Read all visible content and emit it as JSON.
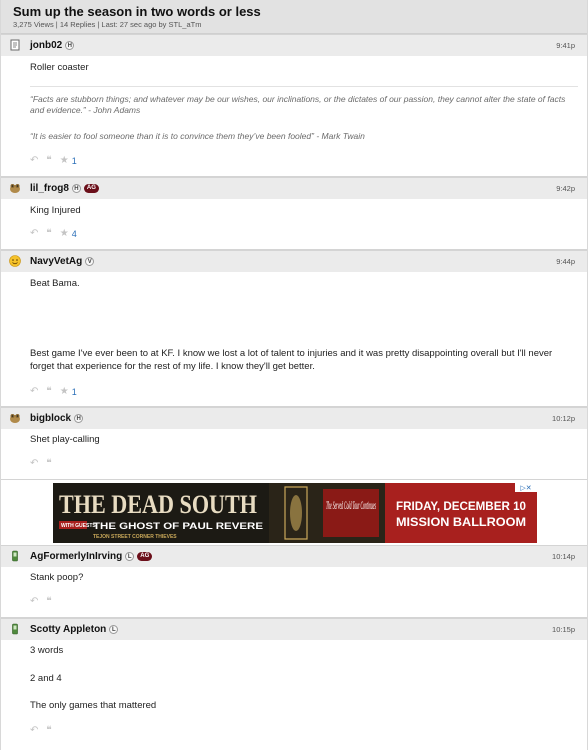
{
  "thread": {
    "title": "Sum up the season in two words or less",
    "meta": "3,275 Views | 14 Replies | Last: 27 sec ago by STL_aTm"
  },
  "posts": [
    {
      "username": "jonb02",
      "badge": "H",
      "time": "9:41p",
      "avatar_icon": "document-icon",
      "lines": [
        "Roller coaster"
      ],
      "quotes": [
        "“Facts are stubborn things; and whatever may be our wishes, our inclinations, or the dictates of our passion, they cannot alter the state of facts and evidence.” - John Adams",
        "“It is easier to fool someone than it is to convince them they’ve been fooled” - Mark Twain"
      ],
      "star_count": "1"
    },
    {
      "username": "lil_frog8",
      "badge": "H",
      "badge2": "AG",
      "time": "9:42p",
      "avatar_icon": "frog-icon",
      "lines": [
        "King Injured"
      ],
      "star_count": "4"
    },
    {
      "username": "NavyVetAg",
      "badge": "V",
      "time": "9:44p",
      "avatar_icon": "smiley-icon",
      "lines": [
        "Beat Bama.",
        "Best game I've ever been to at KF. I know we lost a lot of talent to injuries and it was pretty disappointing overall but I'll never",
        "forget that experience for the rest of my life. I know they'll get better."
      ],
      "star_count": "1"
    },
    {
      "username": "bigblock",
      "badge": "H",
      "time": "10:12p",
      "avatar_icon": "frog-icon",
      "lines": [
        "Shet play-calling"
      ]
    },
    {
      "username": "AgFormerlyInIrving",
      "badge": "L",
      "badge2": "AG",
      "time": "10:14p",
      "avatar_icon": "phone-icon",
      "lines": [
        "Stank poop?"
      ]
    },
    {
      "username": "Scotty Appleton",
      "badge": "L",
      "time": "10:15p",
      "avatar_icon": "phone-icon",
      "lines": [
        "3 words",
        "2 and 4",
        "The only games that mattered"
      ]
    }
  ],
  "ad": {
    "band": "THE DEAD SOUTH",
    "with_guests_label": "WITH GUESTS",
    "guest1": "THE GHOST OF PAUL REVERE",
    "guest2": "TEJON STREET CORNER THIEVES",
    "tour_logo": "The Served Cold Tour Continues",
    "date": "FRIDAY, DECEMBER 10",
    "venue": "MISSION BALLROOM",
    "ad_marker": "▷✕"
  },
  "colors": {
    "header_bg": "#e2e2e2",
    "post_head_bg": "#ebebeb",
    "ag_maroon": "#6b0f1a",
    "link_blue": "#2b6fb8",
    "ad_dark": "#1c1a14",
    "ad_red": "#a8201e",
    "ad_gold": "#c9a85a"
  }
}
